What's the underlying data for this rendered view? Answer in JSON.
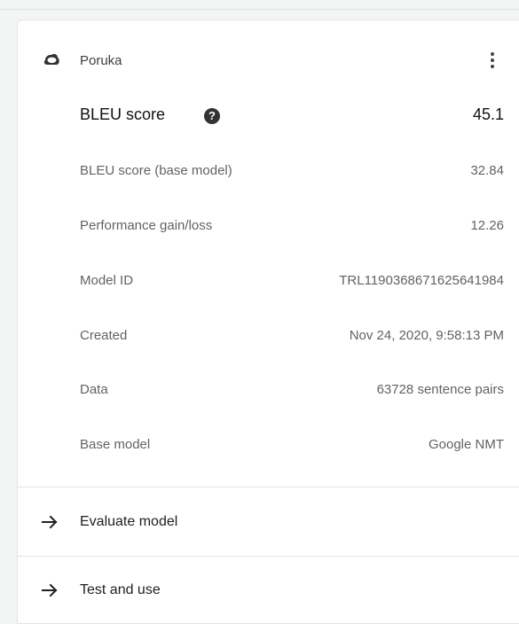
{
  "model": {
    "icon": "cloud-icon",
    "name": "Poruka",
    "menu_icon": "more-vert-icon"
  },
  "bleu": {
    "label": "BLEU score",
    "help_icon": "help-icon",
    "help_glyph": "?",
    "value": "45.1"
  },
  "details": [
    {
      "label": "BLEU score (base model)",
      "value": "32.84"
    },
    {
      "label": "Performance gain/loss",
      "value": "12.26"
    },
    {
      "label": "Model ID",
      "value": "TRL1190368671625641984"
    },
    {
      "label": "Created",
      "value": "Nov 24, 2020, 9:58:13 PM"
    },
    {
      "label": "Data",
      "value": "63728 sentence pairs"
    },
    {
      "label": "Base model",
      "value": "Google NMT"
    }
  ],
  "actions": [
    {
      "icon": "arrow-right-icon",
      "label": "Evaluate model"
    },
    {
      "icon": "arrow-right-icon",
      "label": "Test and use"
    }
  ]
}
